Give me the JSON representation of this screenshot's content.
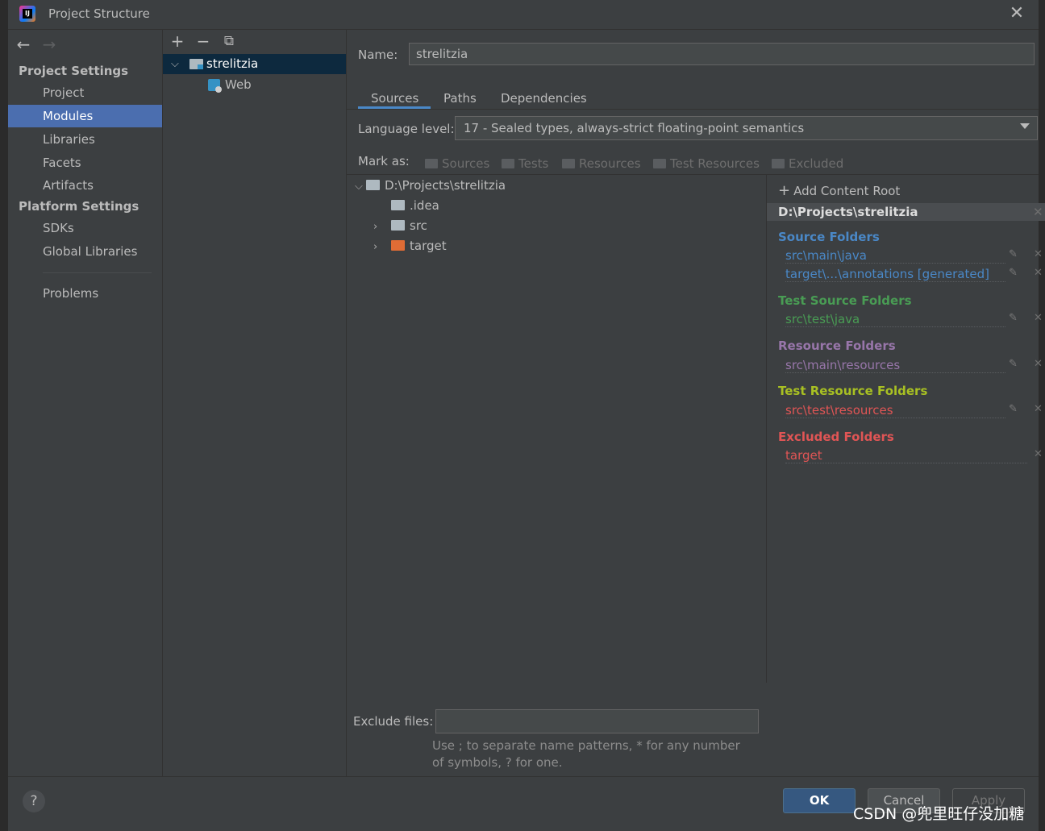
{
  "window": {
    "title": "Project Structure",
    "close_glyph": "✕"
  },
  "nav": {
    "back": "←",
    "forward": "→",
    "project_settings": "Project Settings",
    "items_project": [
      "Project",
      "Modules",
      "Libraries",
      "Facets",
      "Artifacts"
    ],
    "platform_settings": "Platform Settings",
    "items_platform": [
      "SDKs",
      "Global Libraries"
    ],
    "problems": "Problems",
    "selected": "Modules"
  },
  "module_tree": {
    "toolbar": {
      "add": "+",
      "remove": "−",
      "copy": "⧉"
    },
    "root": {
      "expand": "⌵",
      "label": "strelitzia"
    },
    "child": {
      "label": "Web"
    }
  },
  "content": {
    "name_label": "Name:",
    "name_value": "strelitzia",
    "tabs": [
      "Sources",
      "Paths",
      "Dependencies"
    ],
    "active_tab": "Sources",
    "language_label": "Language level:",
    "language_value": "17 - Sealed types, always-strict floating-point semantics",
    "mark_as_label": "Mark as:",
    "mark_buttons": [
      "Sources",
      "Tests",
      "Resources",
      "Test Resources",
      "Excluded"
    ],
    "file_tree": {
      "root": "D:\\Projects\\strelitzia",
      "children": [
        ".idea",
        "src",
        "target"
      ]
    },
    "exclude_label": "Exclude files:",
    "exclude_value": "",
    "exclude_hint": "Use ; to separate name patterns, * for any number of symbols, ? for one."
  },
  "roots": {
    "add_root": "Add Content Root",
    "add_glyph": "+",
    "root_path": "D:\\Projects\\strelitzia",
    "source_folders_title": "Source Folders",
    "source_folders": [
      "src\\main\\java",
      "target\\...\\annotations [generated]"
    ],
    "test_source_title": "Test Source Folders",
    "test_source_folders": [
      "src\\test\\java"
    ],
    "resource_title": "Resource Folders",
    "resource_folders": [
      "src\\main\\resources"
    ],
    "test_resource_title": "Test Resource Folders",
    "test_resource_folders": [
      "src\\test\\resources"
    ],
    "excluded_title": "Excluded Folders",
    "excluded_folders": [
      "target"
    ],
    "edit_glyph": "✎",
    "remove_glyph": "✕"
  },
  "colors": {
    "source": "#4a88c7",
    "test_source": "#499c54",
    "resource": "#9876aa",
    "test_resource": "#a8c023",
    "excluded": "#e05555",
    "selection": "#4b6eaf"
  },
  "buttons": {
    "help": "?",
    "ok": "OK",
    "cancel": "Cancel",
    "apply": "Apply"
  },
  "watermark": "CSDN @兜里旺仔没加糖"
}
